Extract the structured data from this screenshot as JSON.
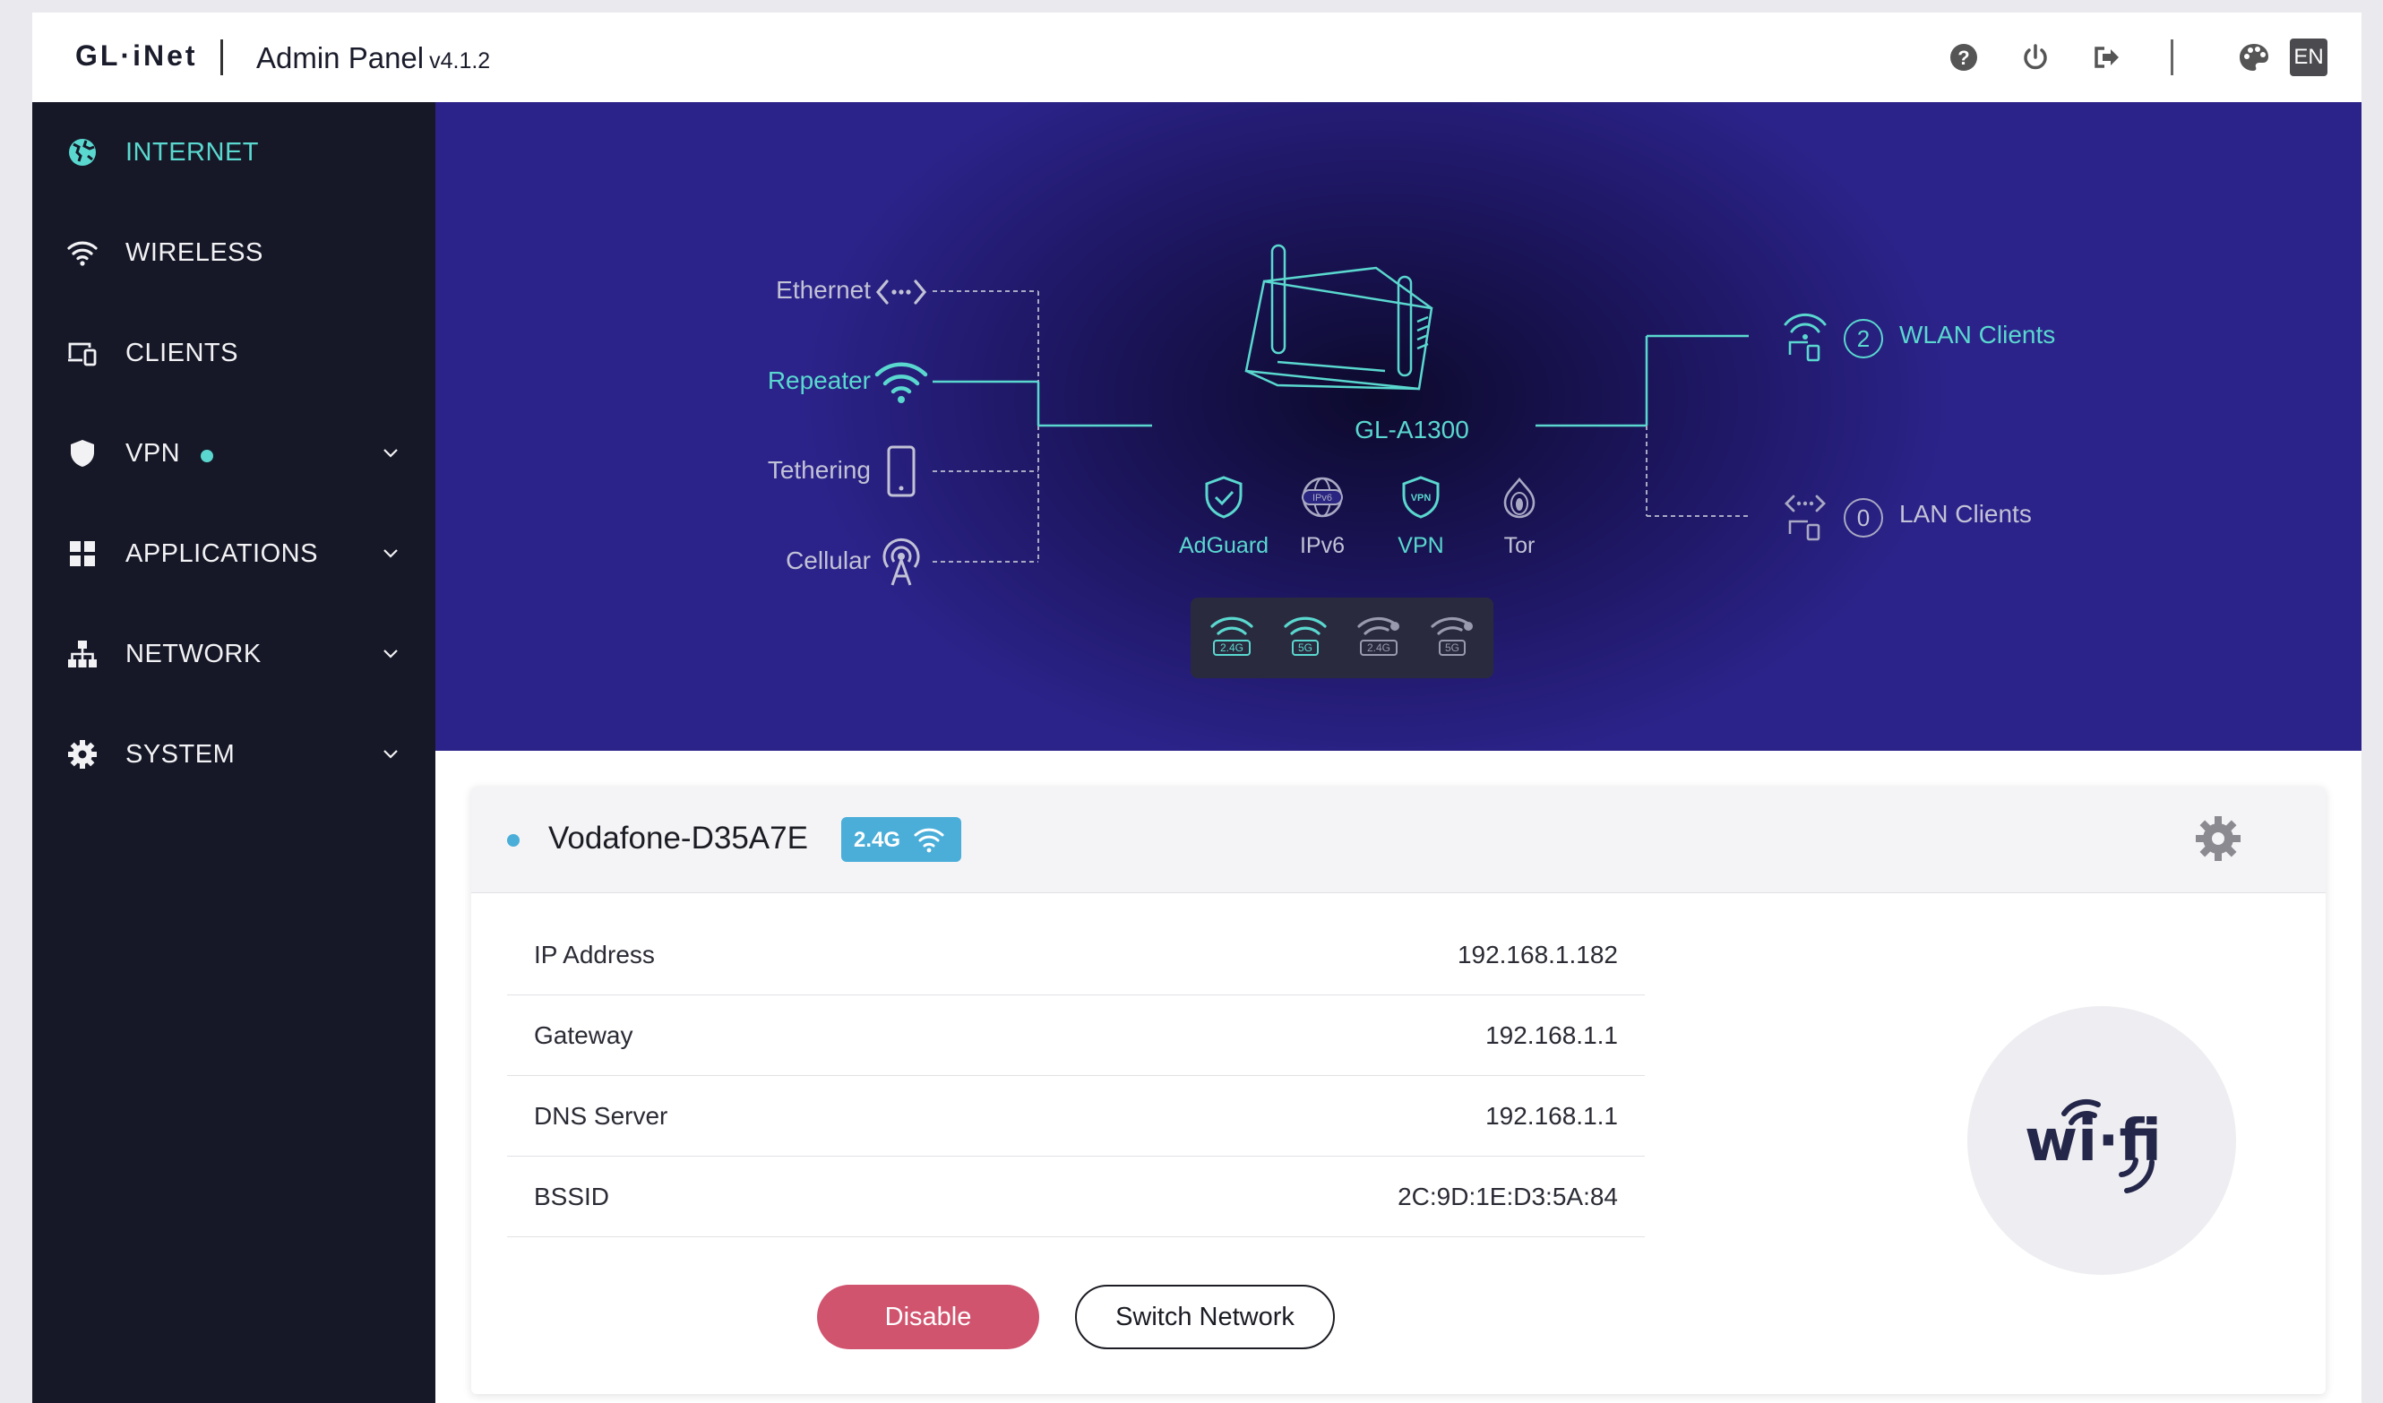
{
  "header": {
    "logo": "GL·iNet",
    "title": "Admin Panel",
    "version": "v4.1.2",
    "language": "EN",
    "icons": [
      "help-icon",
      "power-icon",
      "logout-icon",
      "theme-palette-icon"
    ]
  },
  "sidebar": {
    "items": [
      {
        "label": "INTERNET",
        "icon": "globe-icon",
        "active": true
      },
      {
        "label": "WIRELESS",
        "icon": "wifi-icon"
      },
      {
        "label": "CLIENTS",
        "icon": "devices-icon"
      },
      {
        "label": "VPN",
        "icon": "shield-icon",
        "status_dot": true
      },
      {
        "label": "APPLICATIONS",
        "icon": "apps-grid-icon"
      },
      {
        "label": "NETWORK",
        "icon": "network-tree-icon"
      },
      {
        "label": "SYSTEM",
        "icon": "gear-icon"
      }
    ]
  },
  "topology": {
    "sources": [
      {
        "label": "Ethernet",
        "active": false
      },
      {
        "label": "Repeater",
        "active": true
      },
      {
        "label": "Tethering",
        "active": false
      },
      {
        "label": "Cellular",
        "active": false
      }
    ],
    "router_name": "GL-A1300",
    "features": [
      {
        "label": "AdGuard",
        "active": true
      },
      {
        "label": "IPv6",
        "active": false
      },
      {
        "label": "VPN",
        "active": true
      },
      {
        "label": "Tor",
        "active": false
      }
    ],
    "bands": [
      {
        "label": "2.4G",
        "active": true
      },
      {
        "label": "5G",
        "active": true
      },
      {
        "label": "2.4G",
        "active": false
      },
      {
        "label": "5G",
        "active": false
      }
    ],
    "clients": [
      {
        "count": "2",
        "label": "WLAN Clients",
        "active": true
      },
      {
        "count": "0",
        "label": "LAN Clients",
        "active": false
      }
    ]
  },
  "connection": {
    "ssid": "Vodafone-D35A7E",
    "band": "2.4G",
    "rows": [
      {
        "key": "IP Address",
        "value": "192.168.1.182"
      },
      {
        "key": "Gateway",
        "value": "192.168.1.1"
      },
      {
        "key": "DNS Server",
        "value": "192.168.1.1"
      },
      {
        "key": "BSSID",
        "value": "2C:9D:1E:D3:5A:84"
      }
    ],
    "disable_label": "Disable",
    "switch_label": "Switch Network"
  },
  "colors": {
    "accent": "#5ad8cf",
    "sidebar_bg": "#161827",
    "disable_btn": "#d1546f",
    "band_badge": "#4aaed9"
  }
}
